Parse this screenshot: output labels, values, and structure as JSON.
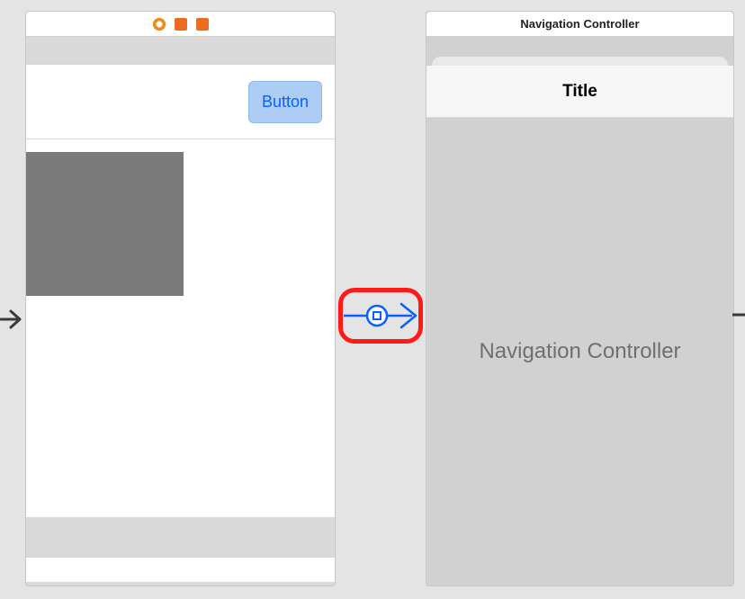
{
  "left_scene": {
    "icons": [
      "first-responder-icon",
      "view-controller-icon",
      "exit-icon"
    ],
    "button_label": "Button"
  },
  "right_scene": {
    "titlebar": "Navigation Controller",
    "navbar_title": "Title",
    "placeholder": "Navigation Controller"
  },
  "segue": {
    "type": "show",
    "highlighted": true
  },
  "colors": {
    "accent": "#0a60ff",
    "highlight": "#ff1a1a",
    "ib_orange": "#ec6c1f"
  }
}
